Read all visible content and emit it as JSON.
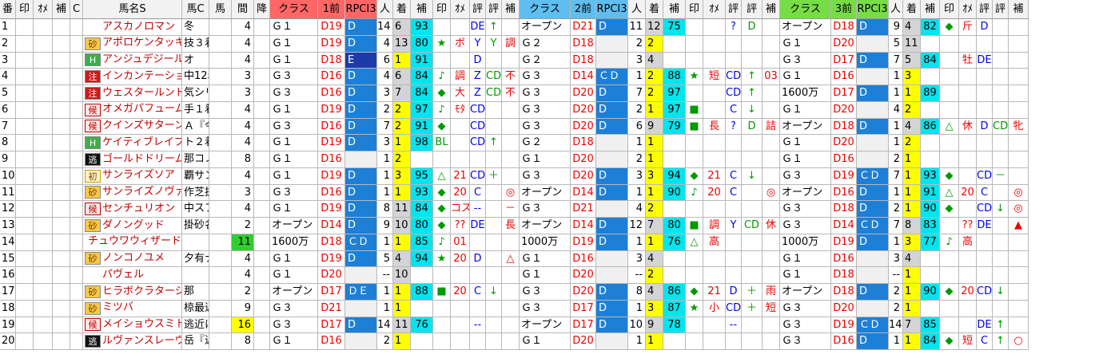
{
  "headers": [
    "番",
    "印",
    "ｵﾒ",
    "補",
    "C",
    "馬名S",
    "馬C",
    "馬",
    "間",
    "降",
    "クラス",
    "1前",
    "RPCI3",
    "人",
    "着",
    "補",
    "印",
    "ｵﾒ",
    "評",
    "評",
    "補",
    "クラス",
    "2前",
    "RPCI3",
    "人",
    "着",
    "補",
    "印",
    "ｵﾒ",
    "評",
    "評",
    "補",
    "クラス",
    "3前",
    "RPCI3",
    "人",
    "着",
    "補",
    "印",
    "ｵﾒ",
    "評",
    "評",
    "補"
  ],
  "rows": [
    {
      "num": "1",
      "badge": "",
      "name": "アスカノロマン",
      "uc": "冬",
      "kan": "4",
      "r1": {
        "cls": "Ｇ１",
        "dist": "D19",
        "rp": "D",
        "pop": "14",
        "fin": "6",
        "hos": "93",
        "m1": "",
        "m2": "",
        "h1": "DE",
        "h2": "↑",
        "h3": ""
      },
      "r2": {
        "cls": "オープン",
        "dist": "D21",
        "rp": "D",
        "pop": "11",
        "fin": "12",
        "hos": "75",
        "m1": "",
        "m2": "",
        "h1": "?",
        "h2": "D",
        "h3": ""
      },
      "r3": {
        "cls": "オープン",
        "dist": "D18",
        "rp": "D",
        "pop": "9",
        "fin": "4",
        "hos": "82",
        "m1": "◆",
        "m2": "斤",
        "h1": "D",
        "h2": "",
        "h3": ""
      }
    },
    {
      "num": "2",
      "badge": "砂",
      "name": "アポロケンタッキー",
      "uc": "技３着",
      "kan": "4",
      "r1": {
        "cls": "Ｇ１",
        "dist": "D19",
        "rp": "D",
        "pop": "4",
        "fin": "13",
        "hos": "80",
        "m1": "★",
        "m2": "ボ",
        "h1": "Y",
        "h2": "Y",
        "h3": "調"
      },
      "r2": {
        "cls": "Ｇ２",
        "dist": "D18",
        "rp": "",
        "pop": "2",
        "fin": "2",
        "hos": "",
        "m1": "",
        "m2": "",
        "h1": "",
        "h2": "",
        "h3": ""
      },
      "r3": {
        "cls": "Ｇ１",
        "dist": "D20",
        "rp": "",
        "pop": "5",
        "fin": "11",
        "hos": "",
        "m1": "",
        "m2": "",
        "h1": "",
        "h2": "",
        "h3": ""
      }
    },
    {
      "num": "3",
      "badge": "H",
      "name": "アンジュデジール",
      "uc": "オ",
      "kan": "4",
      "r1": {
        "cls": "Ｇ１",
        "dist": "D18",
        "rp": "E",
        "pop": "6",
        "fin": "1",
        "hos": "91",
        "m1": "",
        "m2": "",
        "h1": "D",
        "h2": "",
        "h3": ""
      },
      "r2": {
        "cls": "Ｇ２",
        "dist": "D18",
        "rp": "",
        "pop": "3",
        "fin": "4",
        "hos": "",
        "m1": "",
        "m2": "",
        "h1": "",
        "h2": "",
        "h3": ""
      },
      "r3": {
        "cls": "Ｇ３",
        "dist": "D17",
        "rp": "D",
        "pop": "7",
        "fin": "5",
        "hos": "84",
        "m1": "",
        "m2": "牡",
        "h1": "DE",
        "h2": "",
        "h3": ""
      }
    },
    {
      "num": "4",
      "badge": "注",
      "name": "インカンテーション",
      "uc": "中12着",
      "kan": "3",
      "r1": {
        "cls": "Ｇ３",
        "dist": "D16",
        "rp": "D",
        "pop": "4",
        "fin": "6",
        "hos": "84",
        "m1": "♪",
        "m2": "調",
        "h1": "Z",
        "h2": "CD",
        "h3": "不"
      },
      "r2": {
        "cls": "Ｇ３",
        "dist": "D14",
        "rp": "ＣＤ",
        "pop": "1",
        "fin": "2",
        "hos": "88",
        "m1": "★",
        "m2": "短",
        "h1": "CD",
        "h2": "↑",
        "h3": "03"
      },
      "r3": {
        "cls": "Ｇ１",
        "dist": "D16",
        "rp": "",
        "pop": "1",
        "fin": "3",
        "hos": "",
        "m1": "",
        "m2": "",
        "h1": "",
        "h2": "",
        "h3": ""
      }
    },
    {
      "num": "5",
      "badge": "注",
      "name": "ウェスタールンド",
      "uc": "気シリ",
      "kan": "3",
      "r1": {
        "cls": "Ｇ３",
        "dist": "D16",
        "rp": "D",
        "pop": "3",
        "fin": "7",
        "hos": "84",
        "m1": "◆",
        "m2": "大",
        "h1": "Z",
        "h2": "CD",
        "h3": "不"
      },
      "r2": {
        "cls": "Ｇ３",
        "dist": "D20",
        "rp": "D",
        "pop": "7",
        "fin": "2",
        "hos": "97",
        "m1": "",
        "m2": "",
        "h1": "CD",
        "h2": "↑",
        "h3": ""
      },
      "r3": {
        "cls": "1600万",
        "dist": "D17",
        "rp": "D",
        "pop": "1",
        "fin": "1",
        "hos": "89",
        "m1": "",
        "m2": "",
        "h1": "",
        "h2": "",
        "h3": ""
      }
    },
    {
      "num": "6",
      "badge": "候",
      "name": "オメガパフューム",
      "uc": "手１着",
      "kan": "4",
      "r1": {
        "cls": "Ｇ１",
        "dist": "D19",
        "rp": "D",
        "pop": "2",
        "fin": "2",
        "hos": "97",
        "m1": "♪",
        "m2": "ﾓﾀ",
        "h1": "CD",
        "h2": "",
        "h3": ""
      },
      "r2": {
        "cls": "Ｇ３",
        "dist": "D20",
        "rp": "D",
        "pop": "2",
        "fin": "1",
        "hos": "97",
        "m1": "■",
        "m2": "",
        "h1": "C",
        "h2": "↓",
        "h3": ""
      },
      "r3": {
        "cls": "Ｇ１",
        "dist": "D20",
        "rp": "",
        "pop": "4",
        "fin": "2",
        "hos": "",
        "m1": "",
        "m2": "",
        "h1": "",
        "h2": "",
        "h3": ""
      }
    },
    {
      "num": "7",
      "badge": "候",
      "name": "クインズサターン",
      "uc": "Ａ『今",
      "kan": "4",
      "r1": {
        "cls": "Ｇ３",
        "dist": "D16",
        "rp": "D",
        "pop": "7",
        "fin": "2",
        "hos": "91",
        "m1": "◆",
        "m2": "",
        "h1": "CD",
        "h2": "",
        "h3": ""
      },
      "r2": {
        "cls": "Ｇ３",
        "dist": "D20",
        "rp": "D",
        "pop": "6",
        "fin": "9",
        "hos": "79",
        "m1": "■",
        "m2": "長",
        "h1": "?",
        "h2": "D",
        "h3": "詰"
      },
      "r3": {
        "cls": "オープン",
        "dist": "D18",
        "rp": "D",
        "pop": "1",
        "fin": "4",
        "hos": "86",
        "m1": "△",
        "m2": "休",
        "h1": "D",
        "h2": "CD",
        "h3": "牝"
      }
    },
    {
      "num": "8",
      "badge": "H",
      "name": "ケイティブレイブ",
      "uc": "ト２着",
      "kan": "4",
      "r1": {
        "cls": "Ｇ１",
        "dist": "D19",
        "rp": "D",
        "pop": "3",
        "fin": "1",
        "hos": "98",
        "m1": "BL",
        "m2": "",
        "h1": "CD",
        "h2": "↑",
        "h3": ""
      },
      "r2": {
        "cls": "Ｇ２",
        "dist": "D18",
        "rp": "",
        "pop": "1",
        "fin": "1",
        "hos": "",
        "m1": "",
        "m2": "",
        "h1": "",
        "h2": "",
        "h3": ""
      },
      "r3": {
        "cls": "Ｇ１",
        "dist": "D20",
        "rp": "",
        "pop": "1",
        "fin": "2",
        "hos": "",
        "m1": "",
        "m2": "",
        "h1": "",
        "h2": "",
        "h3": ""
      }
    },
    {
      "num": "9",
      "badge": "逃",
      "name": "ゴールドドリーム",
      "uc": "那コノ",
      "kan": "8",
      "r1": {
        "cls": "Ｇ１",
        "dist": "D16",
        "rp": "",
        "pop": "1",
        "fin": "2",
        "hos": "",
        "m1": "",
        "m2": "",
        "h1": "",
        "h2": "",
        "h3": ""
      },
      "r2": {
        "cls": "Ｇ１",
        "dist": "D20",
        "rp": "",
        "pop": "2",
        "fin": "1",
        "hos": "",
        "m1": "",
        "m2": "",
        "h1": "",
        "h2": "",
        "h3": ""
      },
      "r3": {
        "cls": "Ｇ１",
        "dist": "D16",
        "rp": "",
        "pop": "2",
        "fin": "1",
        "hos": "",
        "m1": "",
        "m2": "",
        "h1": "",
        "h2": "",
        "h3": ""
      }
    },
    {
      "num": "10",
      "badge": "初",
      "name": "サンライズソア",
      "uc": "覇サン",
      "kan": "4",
      "r1": {
        "cls": "Ｇ１",
        "dist": "D19",
        "rp": "D",
        "pop": "1",
        "fin": "3",
        "hos": "95",
        "m1": "△",
        "m2": "21",
        "h1": "CD",
        "h2": "＋",
        "h3": ""
      },
      "r2": {
        "cls": "Ｇ３",
        "dist": "D20",
        "rp": "D",
        "pop": "3",
        "fin": "3",
        "hos": "94",
        "m1": "◆",
        "m2": "21",
        "h1": "C",
        "h2": "↓",
        "h3": ""
      },
      "r3": {
        "cls": "Ｇ３",
        "dist": "D19",
        "rp": "ＣＤ",
        "pop": "7",
        "fin": "1",
        "hos": "93",
        "m1": "◆",
        "m2": "",
        "h1": "CD",
        "h2": "－",
        "h3": ""
      }
    },
    {
      "num": "11",
      "badge": "砂",
      "name": "サンライズノヴァ",
      "uc": "作芝抜",
      "kan": "3",
      "r1": {
        "cls": "Ｇ３",
        "dist": "D16",
        "rp": "D",
        "pop": "1",
        "fin": "1",
        "hos": "93",
        "m1": "◆",
        "m2": "20",
        "h1": "C",
        "h2": "",
        "h3": "◎"
      },
      "r2": {
        "cls": "オープン",
        "dist": "D14",
        "rp": "D",
        "pop": "1",
        "fin": "1",
        "hos": "90",
        "m1": "♪",
        "m2": "20",
        "h1": "C",
        "h2": "",
        "h3": "◎"
      },
      "r3": {
        "cls": "オープン",
        "dist": "D16",
        "rp": "D",
        "pop": "1",
        "fin": "1",
        "hos": "91",
        "m1": "△",
        "m2": "20",
        "h1": "C",
        "h2": "",
        "h3": "◎"
      }
    },
    {
      "num": "12",
      "badge": "候",
      "name": "センチュリオン",
      "uc": "中スフ",
      "kan": "4",
      "r1": {
        "cls": "Ｇ１",
        "dist": "D19",
        "rp": "D",
        "pop": "8",
        "fin": "11",
        "hos": "84",
        "m1": "◆",
        "m2": "コス",
        "h1": "--",
        "h2": "",
        "h3": "－"
      },
      "r2": {
        "cls": "Ｇ３",
        "dist": "D21",
        "rp": "",
        "pop": "4",
        "fin": "2",
        "hos": "",
        "m1": "",
        "m2": "",
        "h1": "",
        "h2": "",
        "h3": ""
      },
      "r3": {
        "cls": "Ｇ３",
        "dist": "D18",
        "rp": "D",
        "pop": "2",
        "fin": "1",
        "hos": "90",
        "m1": "◆",
        "m2": "",
        "h1": "CD",
        "h2": "↓",
        "h3": "◎"
      }
    },
    {
      "num": "13",
      "badge": "砂",
      "name": "ダノングッド",
      "uc": "掛砂名",
      "kan": "2",
      "r1": {
        "cls": "オープン",
        "dist": "D14",
        "rp": "D",
        "pop": "9",
        "fin": "10",
        "hos": "80",
        "m1": "◆",
        "m2": "??",
        "h1": "DE",
        "h2": "",
        "h3": "長"
      },
      "r2": {
        "cls": "オープン",
        "dist": "D14",
        "rp": "D",
        "pop": "12",
        "fin": "7",
        "hos": "80",
        "m1": "■",
        "m2": "調",
        "h1": "Y",
        "h2": "CD",
        "h3": "休"
      },
      "r3": {
        "cls": "Ｇ３",
        "dist": "D14",
        "rp": "ＣＤ",
        "pop": "7",
        "fin": "8",
        "hos": "83",
        "m1": "",
        "m2": "??",
        "h1": "DE",
        "h2": "",
        "h3": "▲"
      }
    },
    {
      "num": "14",
      "badge": "",
      "name": "チュウワウィザード",
      "uc": "",
      "kan": "11",
      "r1": {
        "cls": "1600万",
        "dist": "D18",
        "rp": "ＣＤ",
        "pop": "1",
        "fin": "1",
        "hos": "85",
        "m1": "♪",
        "m2": "01",
        "h1": "",
        "h2": "",
        "h3": ""
      },
      "r2": {
        "cls": "1000万",
        "dist": "D19",
        "rp": "D",
        "pop": "1",
        "fin": "1",
        "hos": "76",
        "m1": "△",
        "m2": "高",
        "h1": "",
        "h2": "",
        "h3": ""
      },
      "r3": {
        "cls": "1000万",
        "dist": "D19",
        "rp": "D",
        "pop": "1",
        "fin": "3",
        "hos": "77",
        "m1": "♪",
        "m2": "高",
        "h1": "",
        "h2": "",
        "h3": ""
      }
    },
    {
      "num": "15",
      "badge": "砂",
      "name": "ノンコノユメ",
      "uc": "夕有ナ",
      "kan": "4",
      "r1": {
        "cls": "Ｇ１",
        "dist": "D19",
        "rp": "D",
        "pop": "5",
        "fin": "4",
        "hos": "94",
        "m1": "★",
        "m2": "20",
        "h1": "D",
        "h2": "",
        "h3": "△"
      },
      "r2": {
        "cls": "Ｇ１",
        "dist": "D16",
        "rp": "",
        "pop": "3",
        "fin": "4",
        "hos": "",
        "m1": "",
        "m2": "",
        "h1": "",
        "h2": "",
        "h3": ""
      },
      "r3": {
        "cls": "Ｇ１",
        "dist": "D16",
        "rp": "",
        "pop": "3",
        "fin": "4",
        "hos": "",
        "m1": "",
        "m2": "",
        "h1": "",
        "h2": "",
        "h3": ""
      }
    },
    {
      "num": "16",
      "badge": "",
      "name": "パヴェル",
      "uc": "",
      "kan": "4",
      "r1": {
        "cls": "Ｇ１",
        "dist": "D20",
        "rp": "",
        "pop": "--",
        "fin": "10",
        "hos": "",
        "m1": "",
        "m2": "",
        "h1": "",
        "h2": "",
        "h3": ""
      },
      "r2": {
        "cls": "Ｇ１",
        "dist": "D20",
        "rp": "",
        "pop": "--",
        "fin": "2",
        "hos": "",
        "m1": "",
        "m2": "",
        "h1": "",
        "h2": "",
        "h3": ""
      },
      "r3": {
        "cls": "Ｇ１",
        "dist": "D18",
        "rp": "",
        "pop": "--",
        "fin": "1",
        "hos": "",
        "m1": "",
        "m2": "",
        "h1": "",
        "h2": "",
        "h3": ""
      }
    },
    {
      "num": "17",
      "badge": "砂",
      "name": "ヒラボクラターシュ",
      "uc": "那",
      "kan": "2",
      "r1": {
        "cls": "オープン",
        "dist": "D17",
        "rp": "ＤＥ",
        "pop": "1",
        "fin": "1",
        "hos": "88",
        "m1": "■",
        "m2": "20",
        "h1": "C",
        "h2": "↓",
        "h3": ""
      },
      "r2": {
        "cls": "Ｇ３",
        "dist": "D20",
        "rp": "D",
        "pop": "8",
        "fin": "4",
        "hos": "86",
        "m1": "◆",
        "m2": "21",
        "h1": "D",
        "h2": "＋",
        "h3": "雨"
      },
      "r3": {
        "cls": "オープン",
        "dist": "D18",
        "rp": "D",
        "pop": "2",
        "fin": "1",
        "hos": "90",
        "m1": "◆",
        "m2": "20",
        "h1": "CD",
        "h2": "↓",
        "h3": ""
      }
    },
    {
      "num": "18",
      "badge": "砂",
      "name": "ミツバ",
      "uc": "椋最近",
      "kan": "9",
      "r1": {
        "cls": "Ｇ３",
        "dist": "D21",
        "rp": "",
        "pop": "1",
        "fin": "1",
        "hos": "",
        "m1": "",
        "m2": "",
        "h1": "",
        "h2": "",
        "h3": ""
      },
      "r2": {
        "cls": "Ｇ３",
        "dist": "D17",
        "rp": "D",
        "pop": "1",
        "fin": "3",
        "hos": "87",
        "m1": "★",
        "m2": "小",
        "h1": "CD",
        "h2": "＋",
        "h3": "短"
      },
      "r3": {
        "cls": "Ｇ３",
        "dist": "D20",
        "rp": "",
        "pop": "2",
        "fin": "1",
        "hos": "",
        "m1": "",
        "m2": "",
        "h1": "",
        "h2": "",
        "h3": ""
      }
    },
    {
      "num": "19",
      "badge": "候",
      "name": "メイショウスミトモ",
      "uc": "逃近に",
      "kan": "16",
      "r1": {
        "cls": "Ｇ３",
        "dist": "D17",
        "rp": "D",
        "pop": "14",
        "fin": "11",
        "hos": "76",
        "m1": "",
        "m2": "",
        "h1": "--",
        "h2": "",
        "h3": ""
      },
      "r2": {
        "cls": "オープン",
        "dist": "D17",
        "rp": "D",
        "pop": "10",
        "fin": "9",
        "hos": "78",
        "m1": "",
        "m2": "",
        "h1": "--",
        "h2": "",
        "h3": ""
      },
      "r3": {
        "cls": "Ｇ３",
        "dist": "D19",
        "rp": "ＣＤ",
        "pop": "14",
        "fin": "7",
        "hos": "85",
        "m1": "",
        "m2": "",
        "h1": "DE",
        "h2": "↑",
        "h3": ""
      }
    },
    {
      "num": "20",
      "badge": "逃",
      "name": "ルヴァンスレーヴ",
      "uc": "岳『近",
      "kan": "8",
      "r1": {
        "cls": "Ｇ１",
        "dist": "D16",
        "rp": "",
        "pop": "2",
        "fin": "1",
        "hos": "",
        "m1": "",
        "m2": "",
        "h1": "",
        "h2": "",
        "h3": ""
      },
      "r2": {
        "cls": "Ｇ１",
        "dist": "D20",
        "rp": "",
        "pop": "1",
        "fin": "1",
        "hos": "",
        "m1": "",
        "m2": "",
        "h1": "",
        "h2": "",
        "h3": ""
      },
      "r3": {
        "cls": "Ｇ３",
        "dist": "D16",
        "rp": "D",
        "pop": "1",
        "fin": "1",
        "hos": "84",
        "m1": "◆",
        "m2": "短",
        "h1": "C",
        "h2": "↑",
        "h3": "○"
      }
    }
  ]
}
